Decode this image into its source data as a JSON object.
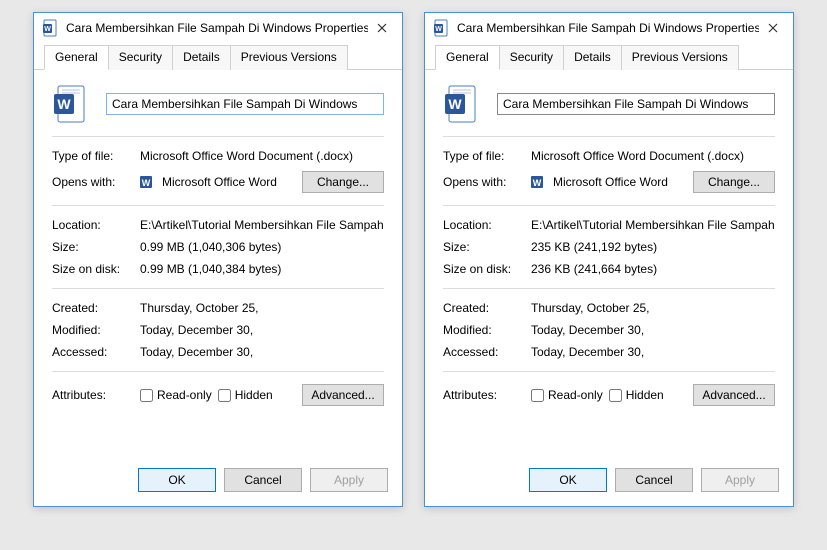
{
  "dialogs": [
    {
      "title": "Cara Membersihkan File Sampah Di Windows Properties",
      "tabs": [
        "General",
        "Security",
        "Details",
        "Previous Versions"
      ],
      "activeTab": "General",
      "filename": "Cara Membersihkan File Sampah Di Windows",
      "typeLabel": "Type of file:",
      "typeValue": "Microsoft Office Word Document (.docx)",
      "opensLabel": "Opens with:",
      "opensValue": "Microsoft Office Word",
      "changeBtn": "Change...",
      "locationLabel": "Location:",
      "locationValue": "E:\\Artikel\\Tutorial Membersihkan File Sampah Di Wi",
      "sizeLabel": "Size:",
      "sizeValue": "0.99 MB (1,040,306 bytes)",
      "diskLabel": "Size on disk:",
      "diskValue": "0.99 MB (1,040,384 bytes)",
      "createdLabel": "Created:",
      "createdValue": "Thursday, October 25,",
      "modifiedLabel": "Modified:",
      "modifiedValue": "Today, December 30,",
      "accessedLabel": "Accessed:",
      "accessedValue": "Today, December 30,",
      "attrLabel": "Attributes:",
      "readonlyLabel": "Read-only",
      "hiddenLabel": "Hidden",
      "advancedBtn": "Advanced...",
      "okBtn": "OK",
      "cancelBtn": "Cancel",
      "applyBtn": "Apply"
    },
    {
      "title": "Cara Membersihkan File Sampah Di Windows Properties",
      "tabs": [
        "General",
        "Security",
        "Details",
        "Previous Versions"
      ],
      "activeTab": "General",
      "filename": "Cara Membersihkan File Sampah Di Windows",
      "typeLabel": "Type of file:",
      "typeValue": "Microsoft Office Word Document (.docx)",
      "opensLabel": "Opens with:",
      "opensValue": "Microsoft Office Word",
      "changeBtn": "Change...",
      "locationLabel": "Location:",
      "locationValue": "E:\\Artikel\\Tutorial Membersihkan File Sampah Di Wi",
      "sizeLabel": "Size:",
      "sizeValue": "235 KB (241,192 bytes)",
      "diskLabel": "Size on disk:",
      "diskValue": "236 KB (241,664 bytes)",
      "createdLabel": "Created:",
      "createdValue": "Thursday, October 25,",
      "modifiedLabel": "Modified:",
      "modifiedValue": "Today, December 30,",
      "accessedLabel": "Accessed:",
      "accessedValue": "Today, December 30,",
      "attrLabel": "Attributes:",
      "readonlyLabel": "Read-only",
      "hiddenLabel": "Hidden",
      "advancedBtn": "Advanced...",
      "okBtn": "OK",
      "cancelBtn": "Cancel",
      "applyBtn": "Apply"
    }
  ]
}
